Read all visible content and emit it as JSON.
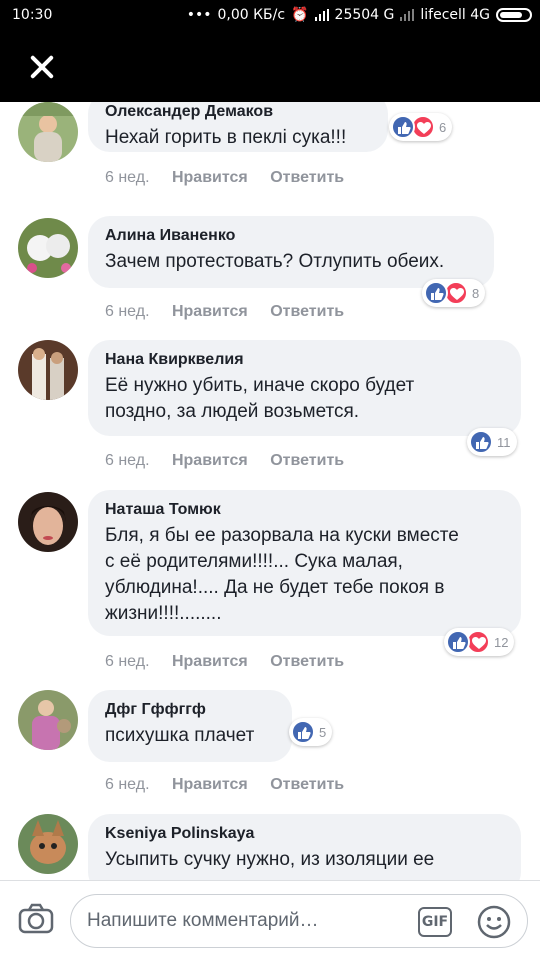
{
  "status_bar": {
    "time": "10:30",
    "speed": "0,00 КБ/с",
    "data_usage": "25504 G",
    "carrier": "lifecell 4G"
  },
  "comments": [
    {
      "author": "Олександер Демаков",
      "text_lines": [
        "Нехай горить в пеклі сука!!!"
      ],
      "age": "6 нед.",
      "like_label": "Нравится",
      "reply_label": "Ответить",
      "reactions": [
        "like",
        "love"
      ],
      "reaction_count": "6"
    },
    {
      "author": "Алина Иваненко",
      "text_lines": [
        "Зачем протестовать? Отлупить обеих."
      ],
      "age": "6 нед.",
      "like_label": "Нравится",
      "reply_label": "Ответить",
      "reactions": [
        "like",
        "love"
      ],
      "reaction_count": "8"
    },
    {
      "author": "Нана Квирквелия",
      "text_lines": [
        "Её нужно убить, иначе скоро будет",
        "поздно, за людей возьмется."
      ],
      "age": "6 нед.",
      "like_label": "Нравится",
      "reply_label": "Ответить",
      "reactions": [
        "like"
      ],
      "reaction_count": "11"
    },
    {
      "author": "Наташа Томюк",
      "text_lines": [
        "Бля,  я бы ее разорвала на куски вместе",
        "с её родителями!!!!... Сука малая,",
        "ублюдина!.... Да не будет тебе покоя в",
        "жизни!!!!........"
      ],
      "age": "6 нед.",
      "like_label": "Нравится",
      "reply_label": "Ответить",
      "reactions": [
        "like",
        "love"
      ],
      "reaction_count": "12"
    },
    {
      "author": "Дфг Гффггф",
      "text_lines": [
        "психушка плачет"
      ],
      "age": "6 нед.",
      "like_label": "Нравится",
      "reply_label": "Ответить",
      "reactions": [
        "like"
      ],
      "reaction_count": "5"
    },
    {
      "author": "Kseniya Polinskaya",
      "text_lines": [
        "Усыпить сучку нужно, из изоляции ее"
      ],
      "age": "",
      "like_label": "",
      "reply_label": "",
      "reactions": [],
      "reaction_count": ""
    }
  ],
  "composer": {
    "placeholder": "Напишите комментарий…",
    "gif_label": "GIF"
  },
  "colors": {
    "like": "#4267b2",
    "love": "#f33e58",
    "bubble": "#f0f2f5",
    "meta": "#90949c"
  }
}
